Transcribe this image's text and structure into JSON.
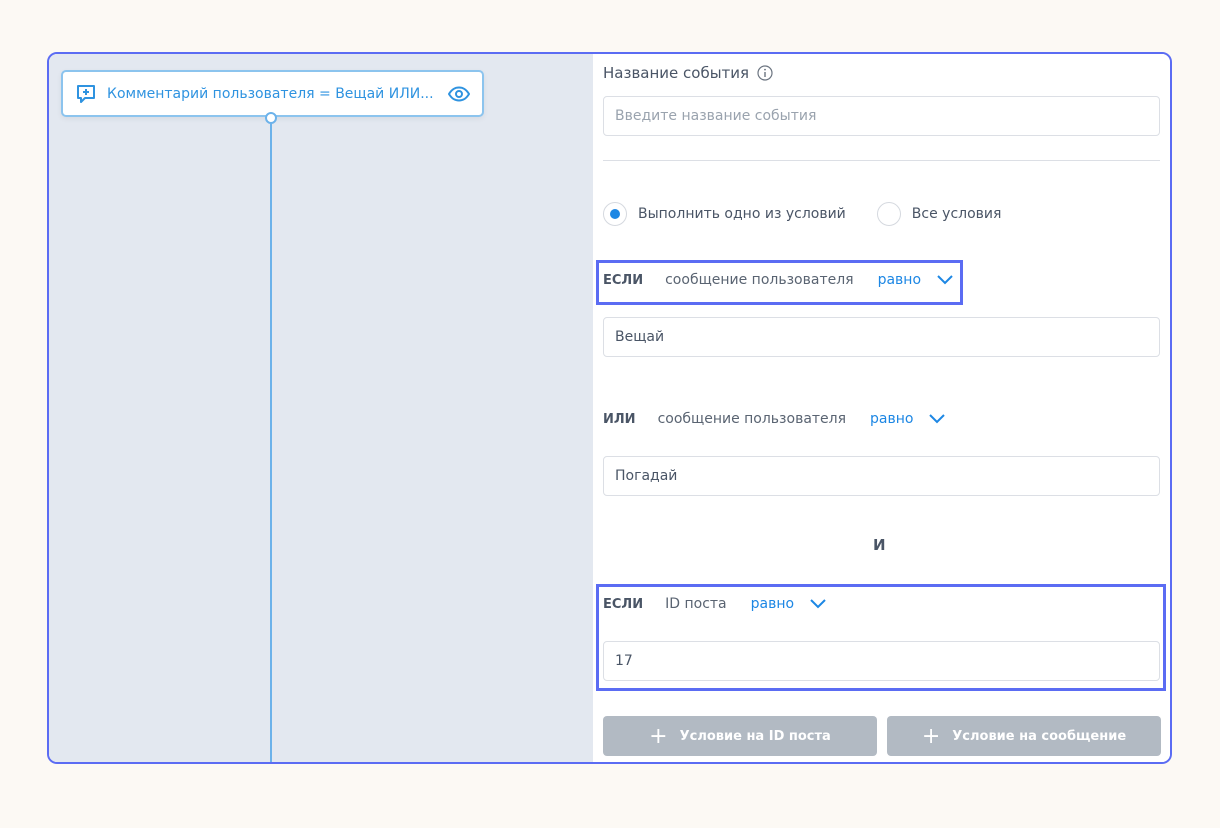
{
  "node": {
    "title": "Комментарий пользователя = Вещай ИЛИ..."
  },
  "panel": {
    "event_name_label": "Название события",
    "event_name_placeholder": "Введите название события",
    "radio_any": "Выполнить одно из условий",
    "radio_all": "Все условия",
    "conditions": [
      {
        "keyword": "ЕСЛИ",
        "field": "сообщение пользователя",
        "operator": "равно",
        "value": "Вещай"
      },
      {
        "keyword": "ИЛИ",
        "field": "сообщение пользователя",
        "operator": "равно",
        "value": "Погадай"
      },
      {
        "keyword": "ЕСЛИ",
        "field": "ID поста",
        "operator": "равно",
        "value": "17"
      }
    ],
    "and_separator": "И",
    "add_post_id_button": "Условие на ID поста",
    "add_message_button": "Условие на сообщение"
  }
}
